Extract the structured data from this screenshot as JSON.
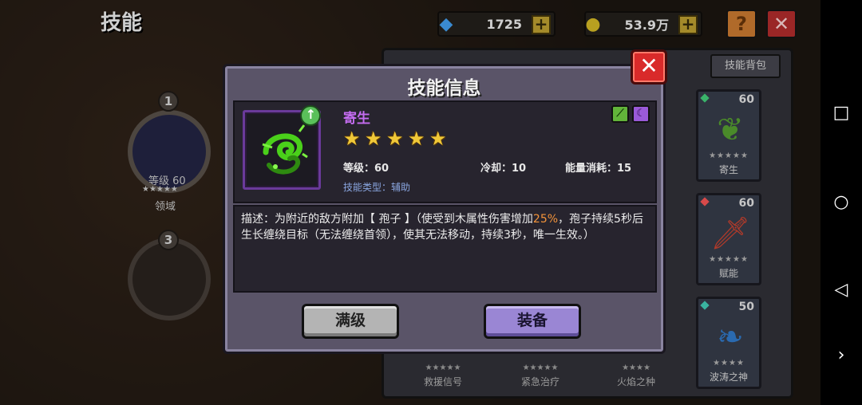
{
  "header": {
    "title": "技能",
    "gems": "1725",
    "gold": "53.9万",
    "plus": "+",
    "help": "?",
    "close": "✕"
  },
  "left_nodes": [
    {
      "num": "1",
      "level_text": "等级 60",
      "stars": "★★★★★",
      "name": "领域"
    },
    {
      "num": "3"
    }
  ],
  "side_panel": {
    "tab_label": "技能背包",
    "cards": [
      {
        "level": "60",
        "stars": "★★★★★",
        "name": "寄生",
        "gem_color": "#3ab46a"
      },
      {
        "level": "60",
        "stars": "★★★★★",
        "name": "赋能",
        "gem_color": "#d84a4a"
      },
      {
        "level": "50",
        "stars": "★★★★",
        "name": "波涛之神",
        "gem_color": "#3ab4a0"
      }
    ],
    "bottom_cards": [
      {
        "stars": "★★★★★",
        "name": "救援信号"
      },
      {
        "stars": "★★★★★",
        "name": "紧急治疗"
      },
      {
        "stars": "★★★★",
        "name": "火焰之种"
      }
    ]
  },
  "modal": {
    "title": "技能信息",
    "close": "✕",
    "skill_name": "寄生",
    "star_count": 5,
    "level_label": "等级：60",
    "cooldown_label": "冷却：10",
    "energy_label": "能量消耗：15",
    "type_label": "技能类型：",
    "type_value": "辅助",
    "upgrade_glyph": "↑",
    "desc_prefix": "描述：为附近的敌方附加【 孢子 】（使受到木属性伤害增加",
    "desc_highlight": "25%",
    "desc_suffix": "，孢子持续5秒后生长缠绕目标（无法缠绕首领），使其无法移动，持续3秒，唯一生效。）",
    "max_button": "满级",
    "equip_button": "装备"
  },
  "icons": {
    "gem": "diamond-icon",
    "gold": "coin-icon",
    "wood_element": "wood-element-icon",
    "dark_element": "dark-element-icon"
  }
}
